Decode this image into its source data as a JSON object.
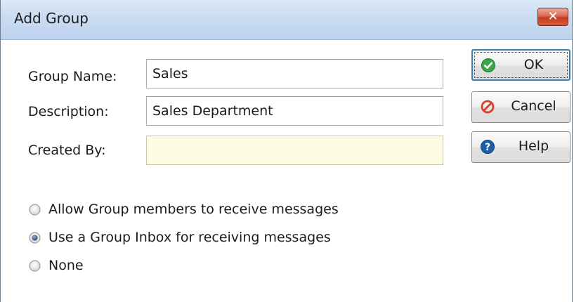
{
  "window": {
    "title": "Add Group",
    "close_glyph": "✕"
  },
  "form": {
    "group_name_label": "Group Name:",
    "group_name_value": "Sales",
    "description_label": "Description:",
    "description_value": "Sales Department",
    "created_by_label": "Created By:",
    "created_by_value": ""
  },
  "buttons": {
    "ok_label": "OK",
    "ok_icon": "check-circle-icon",
    "cancel_label": "Cancel",
    "cancel_icon": "no-entry-icon",
    "help_label": "Help",
    "help_icon": "question-circle-icon"
  },
  "messaging_options": {
    "selected_index": 1,
    "items": [
      {
        "label": "Allow Group members to receive messages",
        "selected": false
      },
      {
        "label": "Use a Group Inbox for receiving messages",
        "selected": true
      },
      {
        "label": "None",
        "selected": false
      }
    ]
  },
  "colors": {
    "titlebar": "#c9dcf1",
    "close_button": "#c43c1e",
    "created_by_field": "#fefce4",
    "ok_icon": "#3aa54a",
    "cancel_icon": "#d6412e",
    "help_icon": "#1f5fa8",
    "default_button_border": "#3c7fb1"
  }
}
